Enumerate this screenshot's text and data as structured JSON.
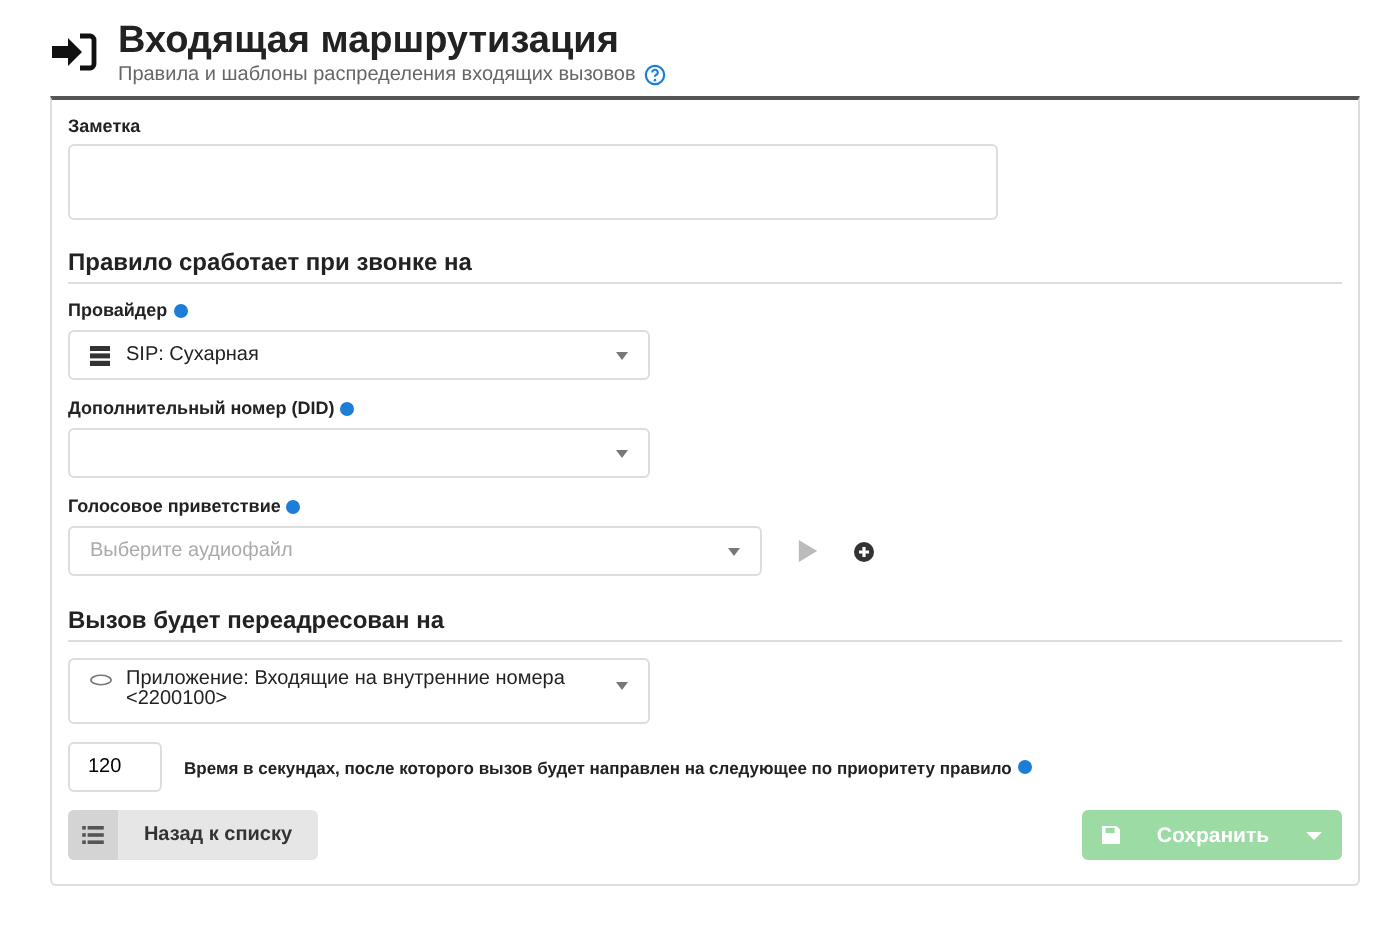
{
  "header": {
    "title": "Входящая маршрутизация",
    "subtitle": "Правила и шаблоны распределения входящих вызовов"
  },
  "note": {
    "label": "Заметка"
  },
  "sections": [
    {
      "title": "Правило сработает при звонке на"
    },
    {
      "title": "Вызов будет переадресован на"
    }
  ],
  "provider": {
    "label": "Провайдер",
    "value": "SIP: Сухарная"
  },
  "did": {
    "label": "Дополнительный номер (DID)"
  },
  "greeting": {
    "label": "Голосовое приветствие",
    "placeholder": "Выберите аудиофайл"
  },
  "target": {
    "value": "Приложение: Входящие на внутренние номера",
    "extra": "<2200100>"
  },
  "timeout": {
    "value": "120",
    "label": "Время в секундах, после которого вызов будет направлен на следующее по приоритету правило"
  },
  "back_button": {
    "label": "Назад к списку"
  },
  "save_button": {
    "label": "Сохранить",
    "disabled": true
  }
}
